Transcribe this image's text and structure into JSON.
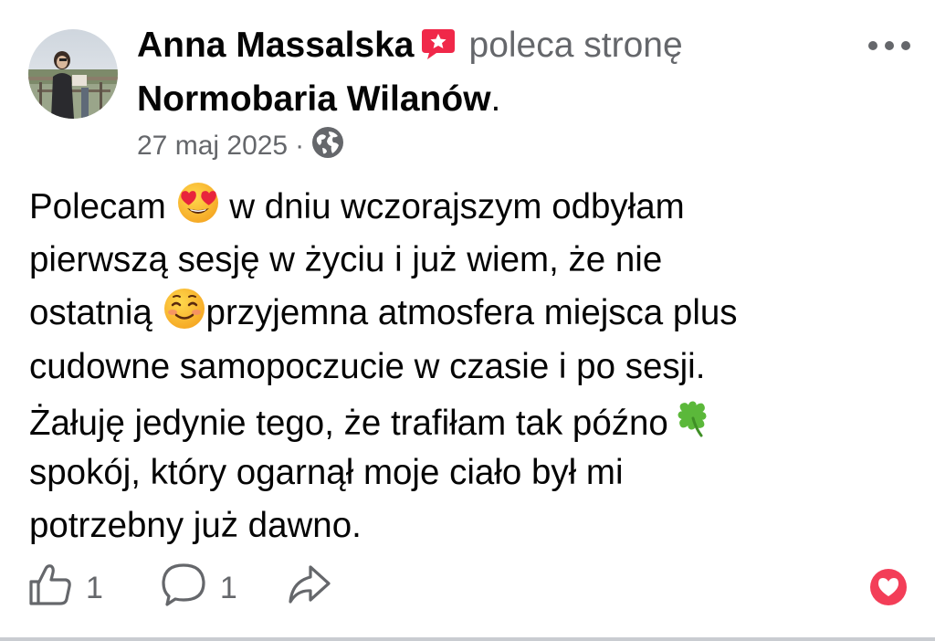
{
  "post": {
    "author_name": "Anna Massalska",
    "verb": "poleca stronę",
    "page_name": "Normobaria Wilanów",
    "period": ".",
    "date": "27 maj 2025",
    "separator": "·",
    "audience_icon": "globe-icon",
    "recommend_icon": "recommendation-star-icon",
    "more_icon": "more-dots-icon",
    "body_lines": {
      "l1a": "Polecam ",
      "l1b": " w dniu wczorajszym odbyłam",
      "l2": "pierwszą sesję w życiu i już wiem, że nie",
      "l3a": "ostatnią ",
      "l3b": "przyjemna atmosfera miejsca plus",
      "l4": "cudowne samopoczucie w czasie i po sesji.",
      "l5a": "Żałuję jedynie tego, że trafiłam tak późno",
      "l6": "spokój, który ogarnął moje ciało był mi",
      "l7": "potrzebny już dawno."
    },
    "emojis": [
      "heart-eyes-emoji",
      "smiling-blush-emoji",
      "four-leaf-clover-emoji"
    ]
  },
  "actions": {
    "like_icon": "thumbs-up-icon",
    "like_count": "1",
    "comment_icon": "comment-bubble-icon",
    "comment_count": "1",
    "share_icon": "share-arrow-icon",
    "reaction_icon": "love-reaction-icon"
  },
  "colors": {
    "text": "#050505",
    "secondary_text": "#65676b",
    "recommend_badge": "#f02849",
    "love_reaction": "#f33e58"
  }
}
